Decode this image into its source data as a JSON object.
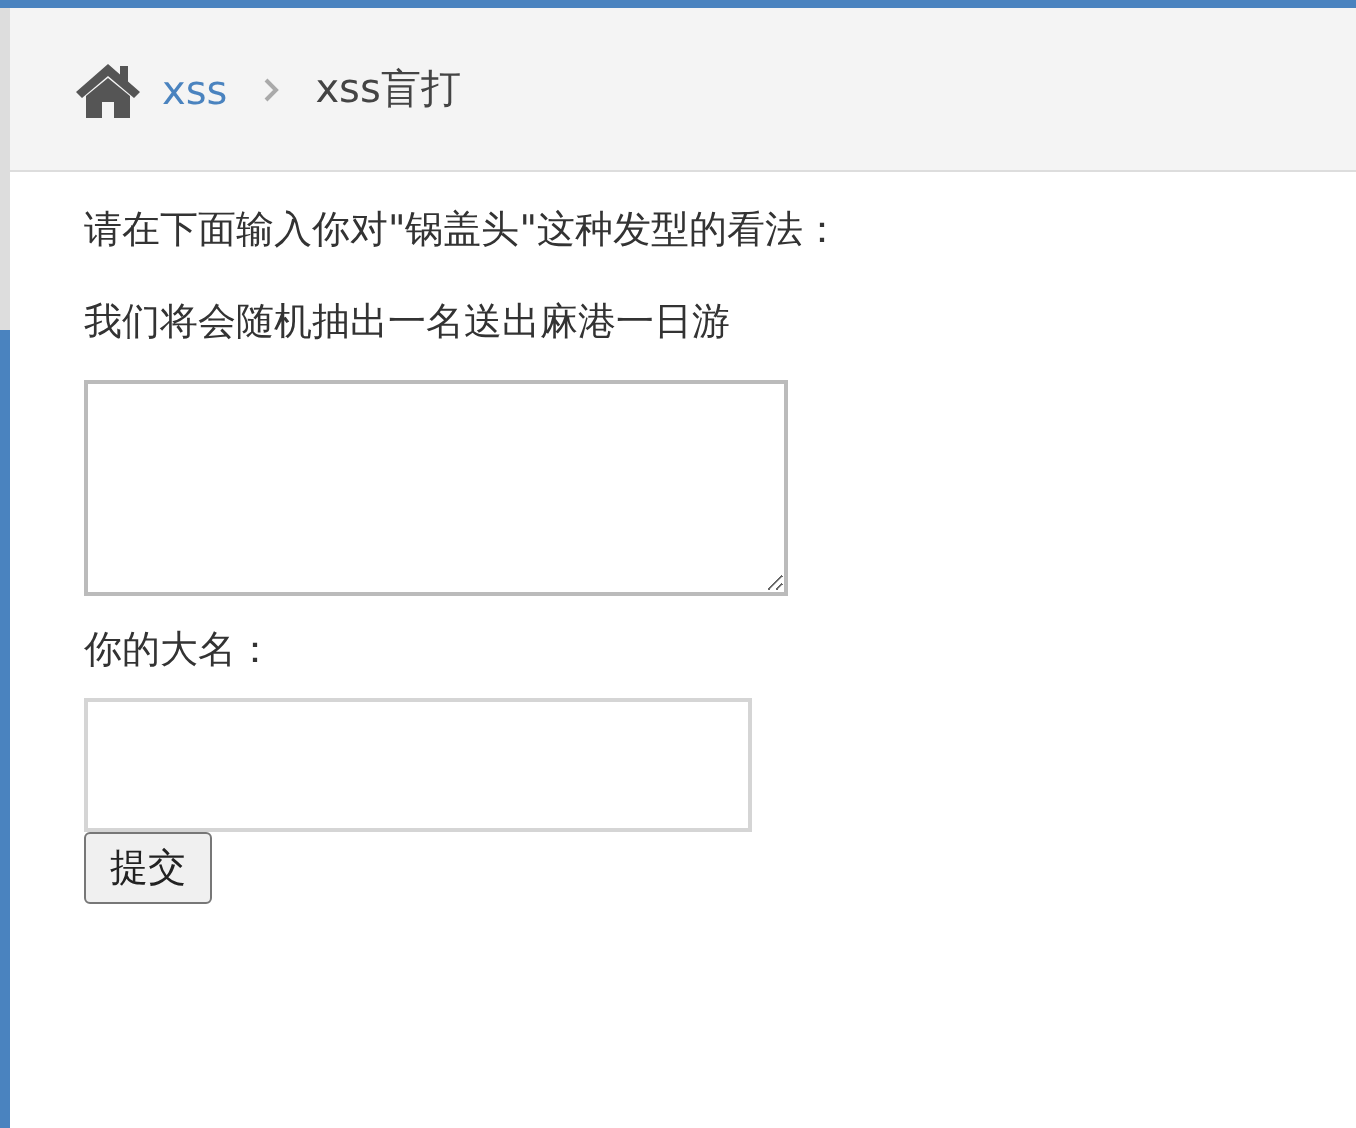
{
  "breadcrumb": [
    {
      "label": "xss",
      "kind": "link"
    },
    {
      "label": "xss盲打",
      "kind": "current"
    }
  ],
  "intro": "请在下面输入你对\"锅盖头\"这种发型的看法：",
  "notice": "我们将会随机抽出一名送出麻港一日游",
  "name_label": "你的大名：",
  "submit": "提交"
}
